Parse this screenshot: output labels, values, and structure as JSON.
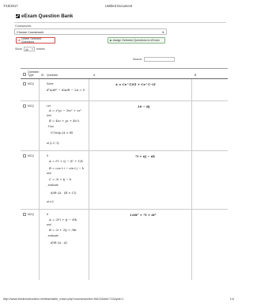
{
  "print": {
    "date": "7/15/2017",
    "doc_title": "Untitled Document",
    "url": "http://www.thinkmoreonline.net/teachable_exam.php?courseworkid=9#1/2&bid=712&pid=1",
    "page": "1/4"
  },
  "panel": {
    "title": "eExam Question Bank",
    "coursework_label": "Coursework:",
    "coursework_value": "Choose Coursework",
    "delete_label": "Delete Selected Questions",
    "assign_label": "Assign Selected Questions to eExam",
    "show_label": "Show",
    "show_value": "All",
    "entries_label": "entries",
    "search_label": "Search:"
  },
  "table": {
    "headers": {
      "check": "",
      "type": "Question Type",
      "id": "ID",
      "question": "Question",
      "a": "A",
      "b": "B"
    },
    "rows": [
      {
        "type": "MCQ",
        "q_lines": [
          "Solve",
          "d²A/dt² − dA/dt − 2A = 0"
        ],
        "answer": "A = Ce^{2t} + Ce^{−t}"
      },
      {
        "type": "MCQ",
        "q_lines": [
          "Let",
          "A = x²yz − 3xz² + xz²",
          "and",
          "B = 4xz + yz + 4x²z",
          ". Find",
          "∂²/∂x∂y (A × B)",
          "at (1,2,−3)"
        ],
        "answer": "16 − 8j"
      },
      {
        "type": "MCQ",
        "q_lines": [
          "If",
          "A = t²i + tj − (t² + 1)k",
          "B = cos t i − sin t j − k",
          "and",
          "C = 3i + tj − k",
          ", evaluate",
          "d/dt (A · (B × C))",
          "at t=0"
        ],
        "answer": "7i + 6j − 6k"
      },
      {
        "type": "MCQ",
        "q_lines": [
          "If",
          "A = 2t²i + tj − 3tk",
          "and",
          "B = 2i + 2tj + 3tk",
          ", evaluate",
          "d/dt (A · A)"
        ],
        "answer": "118t³ + 7t + 6t²"
      }
    ]
  }
}
